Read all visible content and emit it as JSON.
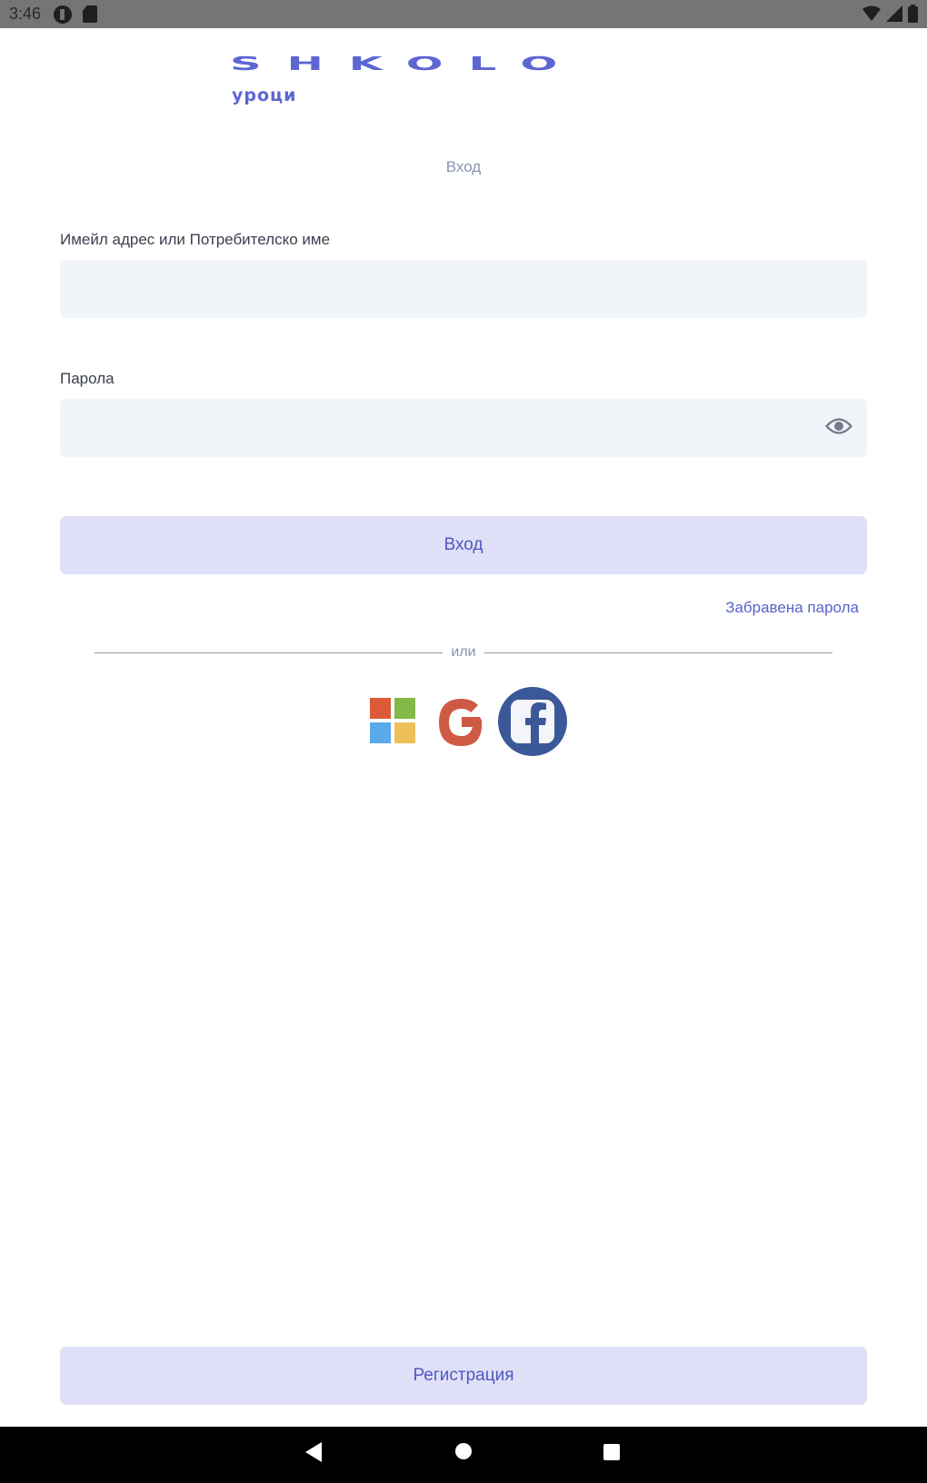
{
  "status_bar": {
    "time": "3:46",
    "icons": [
      "app-notification-icon",
      "sd-card-icon",
      "wifi-icon",
      "signal-icon",
      "battery-icon"
    ]
  },
  "logo": {
    "main_text": "SHKOLO",
    "sub_text": "уроци",
    "color": "#5d66d3"
  },
  "page_title": "Вход",
  "form": {
    "email_label": "Имейл адрес или Потребителско име",
    "email_value": "",
    "password_label": "Парола",
    "password_value": "",
    "login_button": "Вход",
    "forgot_password": "Забравена парола"
  },
  "divider_text": "или",
  "social_logins": [
    "microsoft-icon",
    "google-icon",
    "facebook-icon"
  ],
  "register_button": "Регистрация",
  "colors": {
    "accent": "#5a62cc",
    "button_bg": "#dfe0f7",
    "input_bg": "#f1f4f8",
    "facebook": "#3b5998",
    "google": "#cf5a43"
  }
}
